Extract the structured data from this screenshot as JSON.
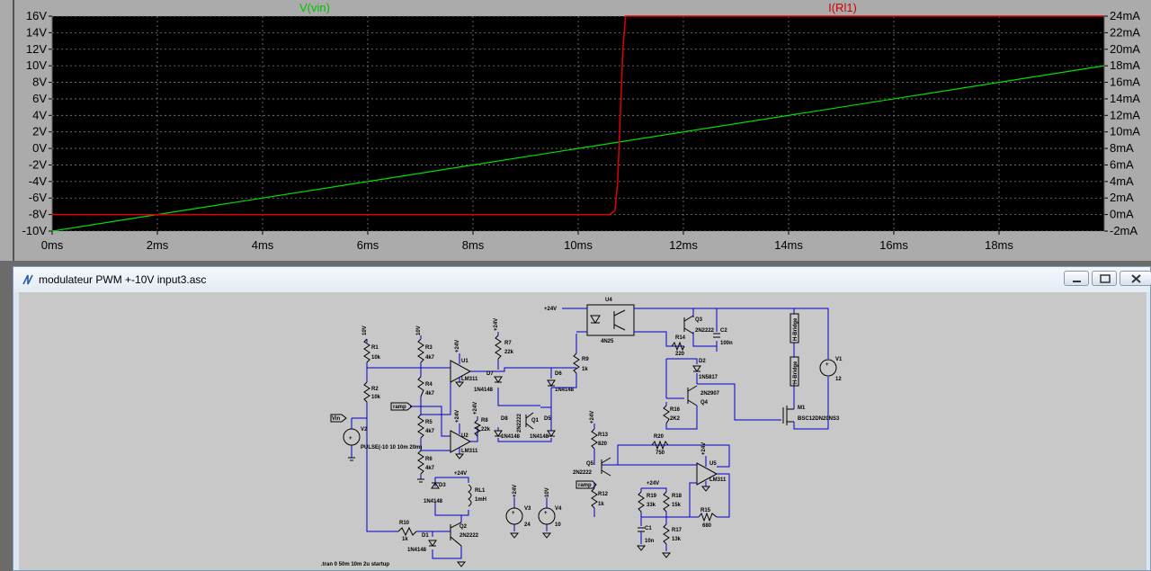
{
  "waveform": {
    "trace1_label": "V(vin)",
    "trace2_label": "I(Rl1)",
    "trace1_color": "#00e000",
    "trace2_color": "#e00000",
    "background": "#000000",
    "left_axis_ticks": [
      "16V",
      "14V",
      "12V",
      "10V",
      "8V",
      "6V",
      "4V",
      "2V",
      "0V",
      "-2V",
      "-4V",
      "-6V",
      "-8V",
      "-10V"
    ],
    "right_axis_ticks": [
      "24mA",
      "22mA",
      "20mA",
      "18mA",
      "16mA",
      "14mA",
      "12mA",
      "10mA",
      "8mA",
      "6mA",
      "4mA",
      "2mA",
      "0mA",
      "-2mA"
    ],
    "x_axis_ticks": [
      "0ms",
      "2ms",
      "4ms",
      "6ms",
      "8ms",
      "10ms",
      "12ms",
      "14ms",
      "16ms",
      "18ms"
    ]
  },
  "chart_data": {
    "type": "line",
    "x_unit": "ms",
    "xlim": [
      0,
      20
    ],
    "ylim_left": [
      -10,
      16
    ],
    "ylim_right": [
      -2,
      24
    ],
    "series": [
      {
        "name": "V(vin)",
        "axis": "left",
        "x": [
          0,
          20
        ],
        "y": [
          -10,
          10
        ]
      },
      {
        "name": "I(Rl1)",
        "axis": "right",
        "x": [
          0,
          10.6,
          10.7,
          10.75,
          10.8,
          10.85,
          10.9,
          20
        ],
        "y": [
          0,
          0,
          0.5,
          4,
          12,
          20,
          24,
          24
        ]
      }
    ]
  },
  "schematic_window": {
    "title": "modulateur PWM +-10V input3.asc",
    "buttons": {
      "minimize": "minimize",
      "restore": "restore",
      "close": "close"
    }
  },
  "schematic": {
    "labels": {
      "u4": "U4",
      "u4_part": "4N25",
      "plus24_top": "+24V",
      "q3": "Q3",
      "q3_part": "2N2222",
      "c2": "C2",
      "c2_val": "100n",
      "r14": "R14",
      "r14_val": "220",
      "d2": "D2",
      "d2_part": "1N5817",
      "q4_part": "2N2907",
      "q4": "Q4",
      "r16": "R16",
      "r16_val": "2K2",
      "m1": "M1",
      "m1_part": "BSC12DN20NS3",
      "hbridge1": "H-Bridge",
      "hbridge2": "H-Bridge",
      "v1": "V1",
      "v1_val": "12",
      "vin": "Vin",
      "v2": "V2",
      "v2_val": "PULSE(-10 10 10m 20m)",
      "r1": "R1",
      "r1_val": "10k",
      "r2": "R2",
      "r2_val": "10k",
      "v10_a": "10V",
      "v10_b": "10V",
      "r3": "R3",
      "r3_val": "4k7",
      "r4": "R4",
      "r4_val": "4k7",
      "r5": "R5",
      "r5_val": "4k7",
      "r6": "R6",
      "r6_val": "4k7",
      "ramp1": "ramp",
      "ramp2": "ramp",
      "u1": "U1",
      "u1_part": "LM311",
      "u2": "U2",
      "u2_part": "LM311",
      "plus24_u1": "+24V",
      "plus24_u2": "+24V",
      "r7": "R7",
      "r7_val": "22k",
      "plus24_r7": "+24V",
      "d7": "D7",
      "d7_part": "1N4148",
      "r8": "R8",
      "r8_val": "22k",
      "d6": "D6",
      "d6_part": "1N4148",
      "d8": "D8",
      "d8_part": "1N4148",
      "q1": "Q1",
      "q1_part": "2N2222",
      "d5": "D5",
      "d5_part": "1N4148",
      "r9": "R9",
      "r9_val": "1k",
      "d3": "D3",
      "d3_part": "1N4148",
      "rl1": "RL1",
      "rl1_val": "1mH",
      "plus24_rl": "+24V",
      "r10": "R10",
      "r10_val": "1k",
      "d1": "D1",
      "d1_part": "1N4148",
      "q2": "Q2",
      "q2_part": "2N2222",
      "v3": "V3",
      "v3_val": "24",
      "v3_top": "+24V",
      "v4": "V4",
      "v4_val": "10",
      "v4_top": "10V",
      "r13": "R13",
      "r13_val": "820",
      "plus24_r13": "+24V",
      "q5": "Q5",
      "q5_part": "2N2222",
      "r12": "R12",
      "r12_val": "1k",
      "r20": "R20",
      "r20_val": "750",
      "u5": "U5",
      "u5_part": "LM311",
      "plus24_u5": "+24V",
      "plus24_r19": "+24V",
      "r19": "R19",
      "r19_val": "33k",
      "r18": "R18",
      "r18_val": "15k",
      "r17": "R17",
      "r17_val": "13k",
      "r15": "R15",
      "r15_val": "680",
      "c1": "C1",
      "c1_val": "10n",
      "tran": ".tran 0 50m 10m 2u startup"
    }
  }
}
